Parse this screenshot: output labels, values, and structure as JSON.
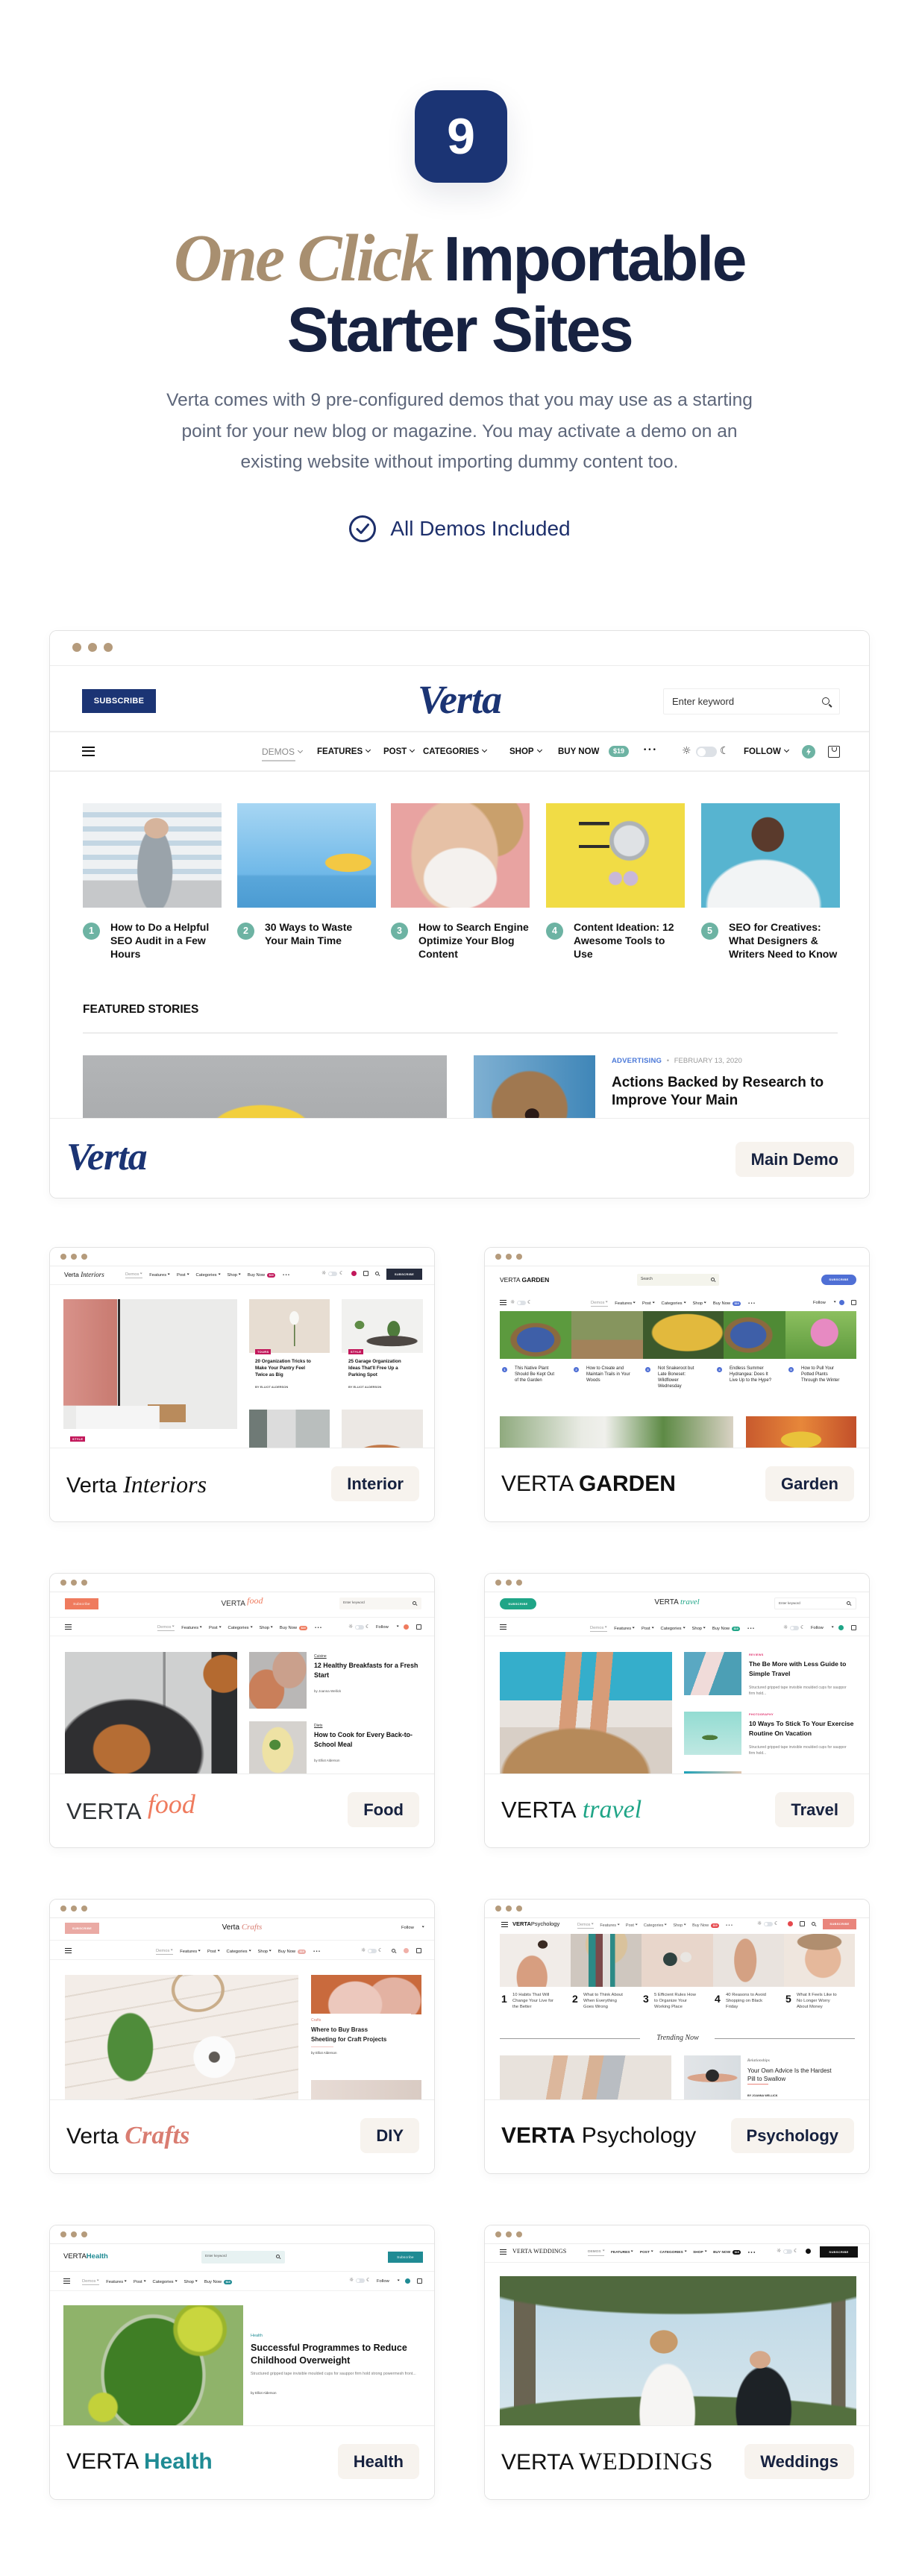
{
  "colors": {
    "brand_navy": "#1b3474",
    "heading": "#172241",
    "script_tan": "#a88f70",
    "body_text": "#5d667a",
    "dots": "#b59b7c",
    "label_bg": "#f7f3ee",
    "label_text": "#16213f",
    "main_accent": "#6db3a3"
  },
  "hero": {
    "badge_number": "9",
    "title_script": "One Click",
    "title_line1": "Importable",
    "title_line2": "Starter Sites",
    "description_lines": [
      "Verta comes with 9 pre-configured demos that you may use as a starting",
      "point for your new blog or magazine. You may activate a demo on an",
      "existing website without importing dummy content too."
    ],
    "included_icon": "check-circle-icon",
    "included_label": "All Demos Included"
  },
  "main_demo": {
    "label": "Main Demo",
    "footer_logo": "Verta",
    "preview": {
      "subscribe": "SUBSCRIBE",
      "logo": "Verta",
      "search_placeholder": "Enter keyword",
      "nav": [
        "DEMOS",
        "FEATURES",
        "POST",
        "CATEGORIES",
        "SHOP",
        "BUY NOW"
      ],
      "active_nav": "DEMOS",
      "price_badge": "$19",
      "follow": "FOLLOW",
      "posts": [
        {
          "number": "1",
          "title": "How to Do a Helpful\nSEO Audit in a Few\nHours"
        },
        {
          "number": "2",
          "title": "30 Ways to Waste\nYour Main Time"
        },
        {
          "number": "3",
          "title": "How to Search Engine\nOptimize Your Blog\nContent"
        },
        {
          "number": "4",
          "title": "Content Ideation: 12\nAwesome Tools to\nUse"
        },
        {
          "number": "5",
          "title": "SEO for Creatives:\nWhat Designers &\nWriters Need to Know"
        }
      ],
      "section_title": "FEATURED STORIES",
      "featured": {
        "category": "ADVERTISING",
        "separator": "•",
        "date": "FEBRUARY 13, 2020",
        "title": "Actions Backed by Research to\nImprove Your Main"
      }
    }
  },
  "mini_nav": [
    "Demos",
    "Features",
    "Post",
    "Categories",
    "Shop",
    "Buy Now"
  ],
  "mini_price": "$19",
  "mini_follow": "Follow",
  "demos": {
    "interior": {
      "label": "Interior",
      "logo_main": "Verta",
      "logo_accent": "Interiors",
      "accent": "#c2185b",
      "preview": {
        "subscribe": "SUBSCRIBE",
        "hero_tag": "STYLE",
        "posts": [
          {
            "tag": "TOURS",
            "title": "20 Organization Tricks to Make Your Pantry Feel Twice as Big",
            "byline": "BY ELLIOT ALDERSON"
          },
          {
            "tag": "STYLE",
            "title": "25 Garage Organization Ideas That'll Free Up a Parking Spot",
            "byline": "BY ELLIOT ALDERSON"
          }
        ]
      }
    },
    "garden": {
      "label": "Garden",
      "logo_main": "VERTA",
      "logo_accent": "GARDEN",
      "accent": "#4f6fd5",
      "preview": {
        "search_placeholder": "Search",
        "subscribe": "SUBSCRIBE",
        "posts": [
          {
            "number": "1",
            "title": "This Native Plant Should Be Kept Out of the Garden"
          },
          {
            "number": "2",
            "title": "How to Create and Maintain Trails in Your Woods"
          },
          {
            "number": "3",
            "title": "Not Snakeroot but Late Boneset: Wildflower Wednesday"
          },
          {
            "number": "4",
            "title": "Endless Summer Hydrangea: Does It Live Up to the Hype?"
          },
          {
            "number": "5",
            "title": "How to Pull Your Potted Plants Through the Winter"
          }
        ]
      }
    },
    "food": {
      "label": "Food",
      "logo_main": "VERTA",
      "logo_accent": "food",
      "accent": "#ef7b5e",
      "preview": {
        "subscribe": "Subscribe",
        "search_placeholder": "Enter keyword",
        "posts": [
          {
            "tag": "Cuisine",
            "title": "12 Healthy Breakfasts for a Fresh Start",
            "byline": "by Joanna Wellick"
          },
          {
            "tag": "Diets",
            "title": "How to Cook for Every Back-to-School Meal",
            "byline": "by Elliot Alderson"
          }
        ]
      }
    },
    "travel": {
      "label": "Travel",
      "logo_main": "VERTA",
      "logo_accent": "travel",
      "accent": "#1fa587",
      "tag_color": "#e0336e",
      "preview": {
        "subscribe": "SUBSCRIBE",
        "search_placeholder": "Enter keyword",
        "posts": [
          {
            "tag": "REVIEWS",
            "title": "The Be More with Less Guide to Simple Travel",
            "excerpt": "Structured gripped tape invisible moulded cups for sauppor firm hold..."
          },
          {
            "tag": "PHOTOGRAPHY",
            "title": "10 Ways To Stick To Your Exercise Routine On Vacation",
            "excerpt": "Structured gripped tape invisible moulded cups for sauppor firm hold..."
          }
        ]
      }
    },
    "diy": {
      "label": "DIY",
      "logo_main": "Verta",
      "logo_accent": "Crafts",
      "accent": "#d97d71",
      "preview": {
        "subscribe": "SUBSCRIBE",
        "post": {
          "tag": "Crafts",
          "title": "Where to Buy Brass Sheeting for Craft Projects",
          "byline": "by Elliot Alderson"
        }
      }
    },
    "psychology": {
      "label": "Psychology",
      "logo_main": "VERTA",
      "logo_accent": "Psychology",
      "accent": "#e5484d",
      "preview": {
        "subscribe": "SUBSCRIBE",
        "posts": [
          {
            "number": "1",
            "title": "10 Habits That Will Change Your Live for the Better"
          },
          {
            "number": "2",
            "title": "What to Think About When Everything Goes Wrong"
          },
          {
            "number": "3",
            "title": "5 Efficient Rules How to Organize Your Working Place"
          },
          {
            "number": "4",
            "title": "40 Reasons to Avoid Shopping on Black Friday"
          },
          {
            "number": "5",
            "title": "What It Feels Like to No Longer Worry About Money"
          }
        ],
        "section_title": "Trending Now",
        "featured": {
          "tag": "Relationships",
          "title": "Your Own Advice Is the Hardest Pill to Swallow",
          "byline": "BY JOANNA WELLICK"
        }
      }
    },
    "health": {
      "label": "Health",
      "logo_main": "VERTA",
      "logo_accent": "Health",
      "accent": "#1f8b94",
      "preview": {
        "search_placeholder": "Enter keyword",
        "subscribe": "Subscribe",
        "post": {
          "tag": "Health",
          "title": "Successful Programmes to Reduce Childhood Overweight",
          "excerpt": "Structured gripped tape invisible moulded cups for sauppor firm hold strong powermesh front...",
          "byline": "by Elliot Alderson"
        }
      }
    },
    "weddings": {
      "label": "Weddings",
      "logo_main": "VERTA",
      "logo_accent": "WEDDINGS",
      "accent": "#111111",
      "preview": {
        "nav": [
          "DEMOS",
          "FEATURES",
          "POST",
          "CATEGORIES",
          "SHOP",
          "BUY NOW"
        ],
        "subscribe": "SUBSCRIBE"
      }
    }
  }
}
